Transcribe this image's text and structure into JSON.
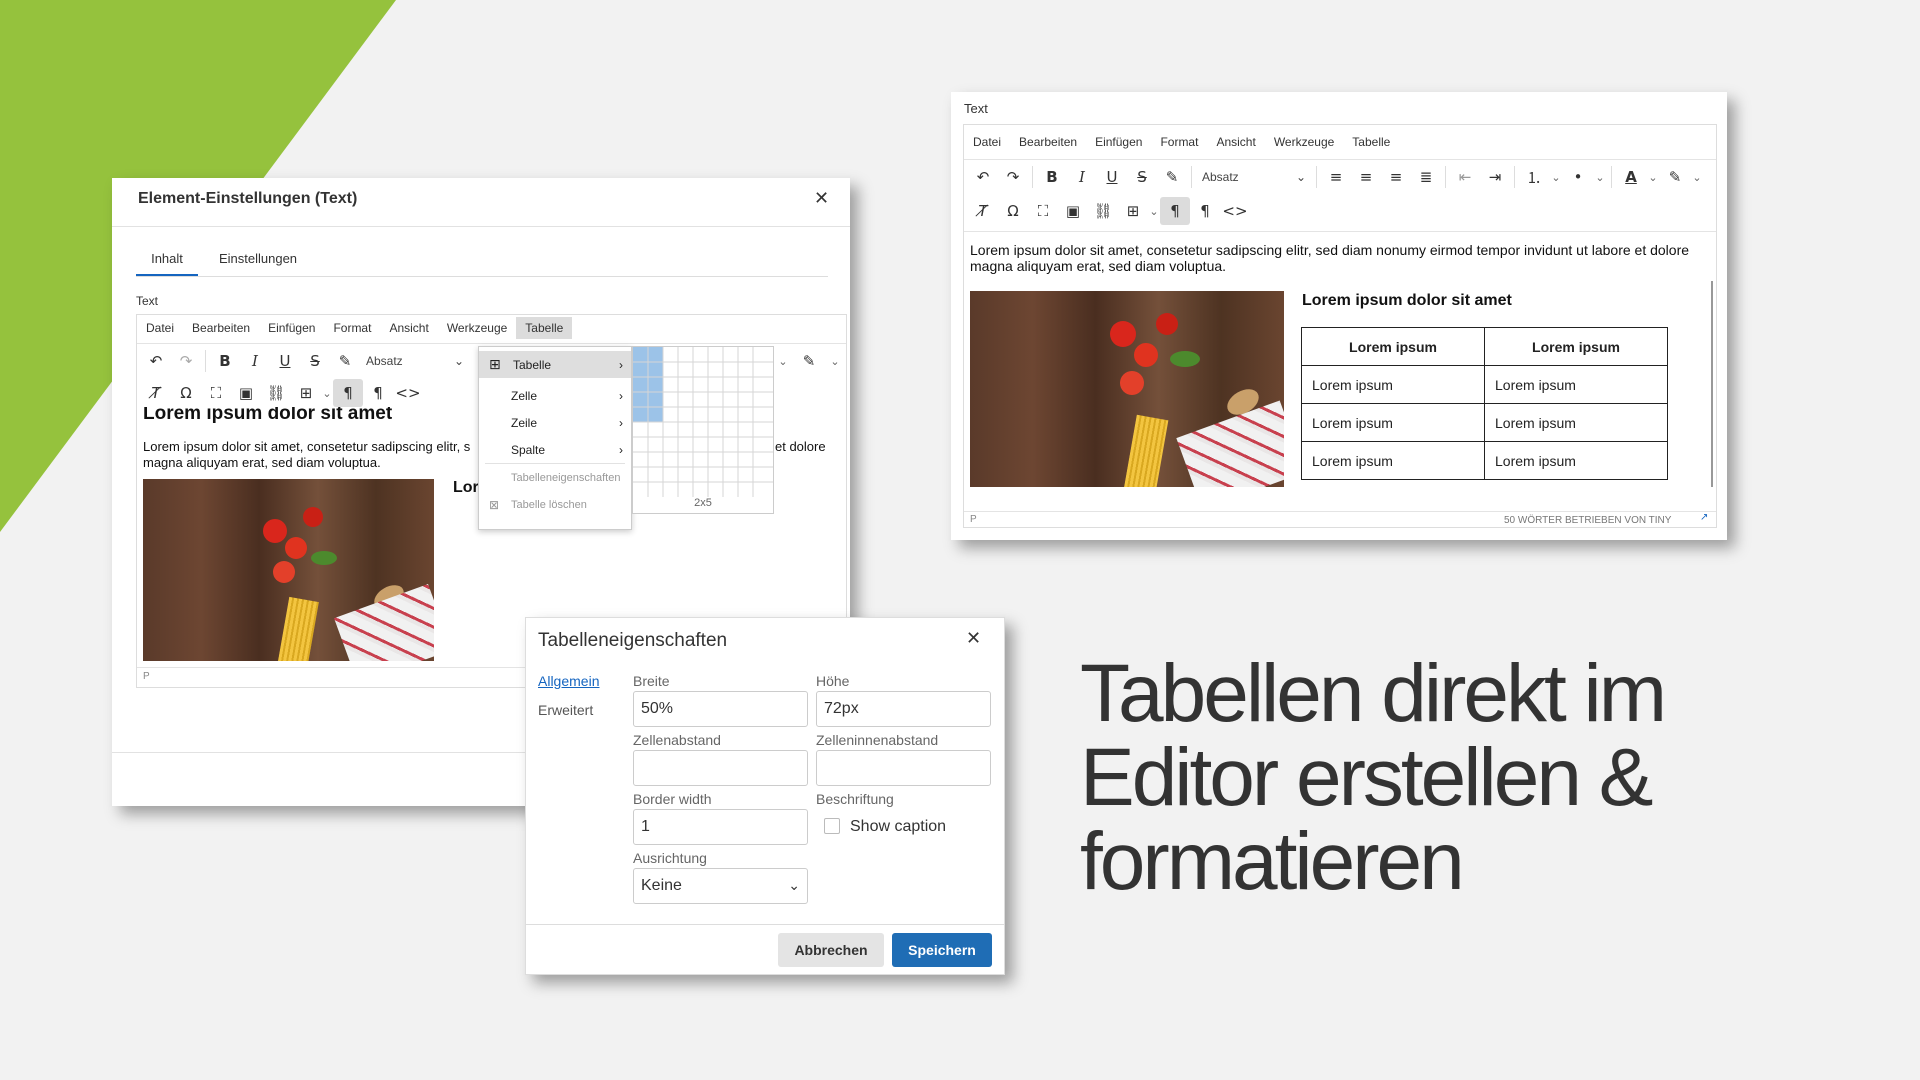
{
  "colors": {
    "accent_green": "#95c23d",
    "primary_button": "#1f6db5",
    "link_blue": "#1565c0",
    "background": "#f2f2f2"
  },
  "headline": {
    "line1": "Tabellen direkt im",
    "line2": "Editor erstellen &",
    "line3": "formatieren"
  },
  "left_dialog": {
    "title": "Element-Einstellungen (Text)",
    "close_icon": "close-icon",
    "tabs": [
      {
        "label": "Inhalt",
        "active": true
      },
      {
        "label": "Einstellungen",
        "active": false
      }
    ],
    "field_label": "Text",
    "menu": [
      "Datei",
      "Bearbeiten",
      "Einfügen",
      "Format",
      "Ansicht",
      "Werkzeuge",
      "Tabelle"
    ],
    "format_select": "Absatz",
    "content": {
      "heading": "Lorem ipsum dolor sit amet",
      "paragraph": "Lorem ipsum dolor sit amet, consetetur sadipscing elitr, s",
      "paragraph_end": "et dolore",
      "paragraph2": "magna aliquyam erat, sed diam voluptua.",
      "partial_heading": "Lor",
      "status": "P"
    },
    "dropdown": {
      "items": [
        {
          "label": "Tabelle",
          "icon": "table-icon",
          "submenu": true,
          "active": true
        },
        {
          "label": "Zelle",
          "submenu": true
        },
        {
          "label": "Zeile",
          "submenu": true
        },
        {
          "label": "Spalte",
          "submenu": true
        },
        {
          "label": "Tabelleneigenschaften",
          "disabled": true
        },
        {
          "label": "Tabelle löschen",
          "icon": "table-delete-icon",
          "disabled": true
        }
      ],
      "grid_size": "2x5"
    }
  },
  "right_editor": {
    "field_label": "Text",
    "menu": [
      "Datei",
      "Bearbeiten",
      "Einfügen",
      "Format",
      "Ansicht",
      "Werkzeuge",
      "Tabelle"
    ],
    "format_select": "Absatz",
    "paragraph": "Lorem ipsum dolor sit amet, consetetur sadipscing elitr, sed diam nonumy eirmod tempor invidunt ut labore et dolore magna aliquyam erat, sed diam voluptua.",
    "heading": "Lorem ipsum dolor sit amet",
    "table": {
      "headers": [
        "Lorem ipsum",
        "Lorem ipsum"
      ],
      "rows": [
        [
          "Lorem ipsum",
          "Lorem ipsum"
        ],
        [
          "Lorem ipsum",
          "Lorem ipsum"
        ],
        [
          "Lorem ipsum",
          "Lorem ipsum"
        ]
      ]
    },
    "status_left": "P",
    "status_right": "50 WÖRTER  BETRIEBEN VON TINY"
  },
  "props_dialog": {
    "title": "Tabelleneigenschaften",
    "tabs": [
      {
        "label": "Allgemein",
        "active": true
      },
      {
        "label": "Erweitert",
        "active": false
      }
    ],
    "fields": {
      "breite": {
        "label": "Breite",
        "value": "50%"
      },
      "hoehe": {
        "label": "Höhe",
        "value": "72px"
      },
      "zellenabstand": {
        "label": "Zellenabstand",
        "value": ""
      },
      "zelleninnenabstand": {
        "label": "Zelleninnenabstand",
        "value": ""
      },
      "border": {
        "label": "Border width",
        "value": "1"
      },
      "beschriftung": {
        "label": "Beschriftung",
        "checkbox": "Show caption",
        "checked": false
      },
      "ausrichtung": {
        "label": "Ausrichtung",
        "value": "Keine"
      }
    },
    "cancel": "Abbrechen",
    "save": "Speichern"
  }
}
